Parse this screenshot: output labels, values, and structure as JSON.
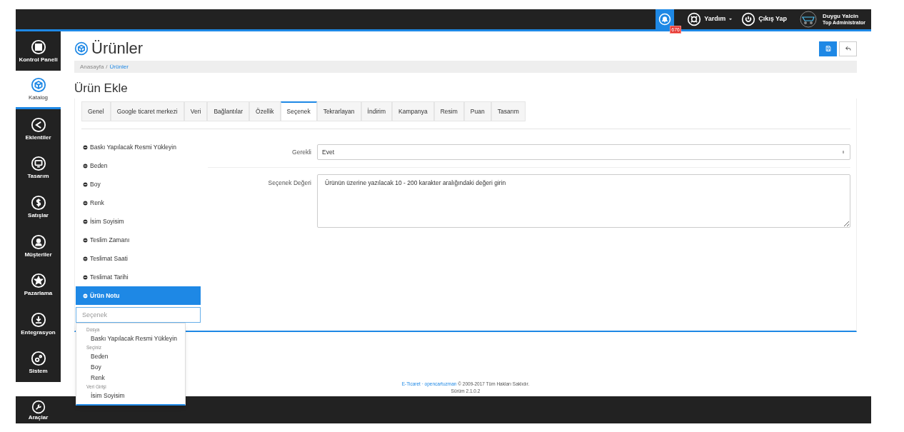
{
  "top_bar": {
    "notification_count": "676",
    "help": "Yardım",
    "logout": "Çıkış Yap",
    "user_name": "Duygu Yalcin",
    "user_role": "Top Administrator"
  },
  "sidebar": {
    "items": [
      {
        "label": "Kontrol Paneli",
        "selected": false
      },
      {
        "label": "Katalog",
        "selected": true
      },
      {
        "label": "Eklentiler",
        "selected": false
      },
      {
        "label": "Tasarım",
        "selected": false
      },
      {
        "label": "Satışlar",
        "selected": false
      },
      {
        "label": "Müşteriler",
        "selected": false
      },
      {
        "label": "Pazarlama",
        "selected": false
      },
      {
        "label": "Entegrasyon",
        "selected": false
      },
      {
        "label": "Sistem",
        "selected": false
      },
      {
        "label": "Araçlar",
        "selected": false
      }
    ]
  },
  "page": {
    "title": "Ürünler",
    "breadcrumb": [
      {
        "label": "Anasayfa",
        "current": false
      },
      {
        "label": "Ürünler",
        "current": true
      }
    ],
    "breadcrumb_separator": "/",
    "subtitle": "Ürün Ekle"
  },
  "tabs": [
    {
      "label": "Genel",
      "selected": false
    },
    {
      "label": "Google ticaret merkezi",
      "selected": false
    },
    {
      "label": "Veri",
      "selected": false
    },
    {
      "label": "Bağlantılar",
      "selected": false
    },
    {
      "label": "Özellik",
      "selected": false
    },
    {
      "label": "Seçenek",
      "selected": true
    },
    {
      "label": "Tekrarlayan",
      "selected": false
    },
    {
      "label": "İndirim",
      "selected": false
    },
    {
      "label": "Kampanya",
      "selected": false
    },
    {
      "label": "Resim",
      "selected": false
    },
    {
      "label": "Puan",
      "selected": false
    },
    {
      "label": "Tasarım",
      "selected": false
    }
  ],
  "options": {
    "items": [
      {
        "label": "Baskı Yapılacak Resmi Yükleyin",
        "selected": false
      },
      {
        "label": "Beden",
        "selected": false
      },
      {
        "label": "Boy",
        "selected": false
      },
      {
        "label": "Renk",
        "selected": false
      },
      {
        "label": "İsim Soyisim",
        "selected": false
      },
      {
        "label": "Teslim Zamanı",
        "selected": false
      },
      {
        "label": "Teslimat Saati",
        "selected": false
      },
      {
        "label": "Teslimat Tarihi",
        "selected": false
      },
      {
        "label": "Ürün Notu",
        "selected": true
      }
    ],
    "search_placeholder": "Seçenek",
    "dropdown": [
      {
        "group": "Dosya",
        "items": [
          "Baskı Yapılacak Resmi Yükleyin"
        ]
      },
      {
        "group": "Seçiniz",
        "items": [
          "Beden",
          "Boy",
          "Renk"
        ]
      },
      {
        "group": "Veri Girişi",
        "items": [
          "İsim Soyisim"
        ]
      }
    ]
  },
  "form": {
    "required_label": "Gerekli",
    "required_value": "Evet",
    "value_label": "Seçenek Değeri",
    "value_text": "Ürünün üzerine yazılacak 10 - 200 karakter aralığındaki değeri girin"
  },
  "footer": {
    "brand": "E-Ticaret ·",
    "link": "opencartuzman",
    "rights": "© 2009-2017 Tüm Hakları Saklıdır.",
    "version": "Sürüm 2.1.0.2"
  }
}
